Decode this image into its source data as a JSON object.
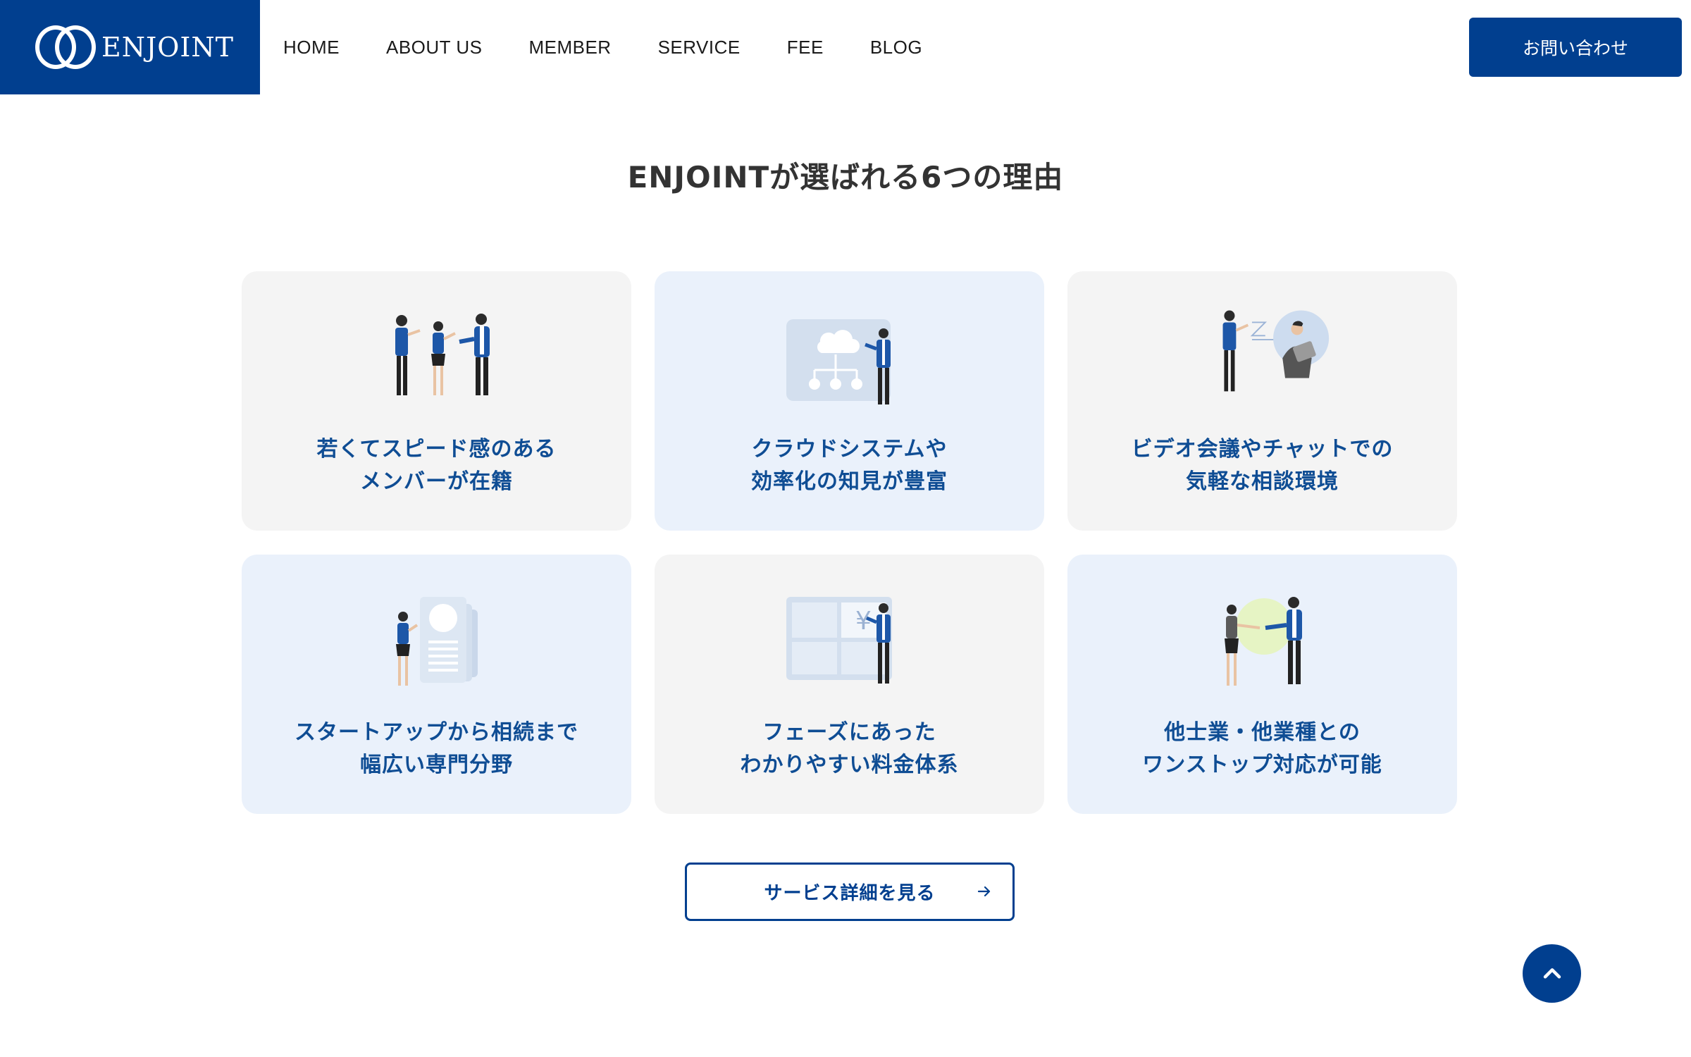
{
  "header": {
    "logo_text": "ENJOINT",
    "nav": [
      "HOME",
      "ABOUT US",
      "MEMBER",
      "SERVICE",
      "FEE",
      "BLOG"
    ],
    "contact_label": "お問い合わせ"
  },
  "section": {
    "title": "ENJOINTが選ばれる6つの理由",
    "cards": [
      {
        "line1": "若くてスピード感のある",
        "line2": "メンバーが在籍",
        "icon": "team-people-icon"
      },
      {
        "line1": "クラウドシステムや",
        "line2": "効率化の知見が豊富",
        "icon": "cloud-system-icon"
      },
      {
        "line1": "ビデオ会議やチャットでの",
        "line2": "気軽な相談環境",
        "icon": "video-chat-icon"
      },
      {
        "line1": "スタートアップから相続まで",
        "line2": "幅広い専門分野",
        "icon": "documents-icon"
      },
      {
        "line1": "フェーズにあった",
        "line2": "わかりやすい料金体系",
        "icon": "yen-pricing-icon"
      },
      {
        "line1": "他士業・他業種との",
        "line2": "ワンストップ対応が可能",
        "icon": "handshake-icon"
      }
    ],
    "detail_button": "サービス詳細を見る"
  },
  "colors": {
    "brand": "#013f8f",
    "card_gray": "#f4f4f4",
    "card_blue": "#eaf1fb",
    "card_text": "#0f4d94"
  }
}
